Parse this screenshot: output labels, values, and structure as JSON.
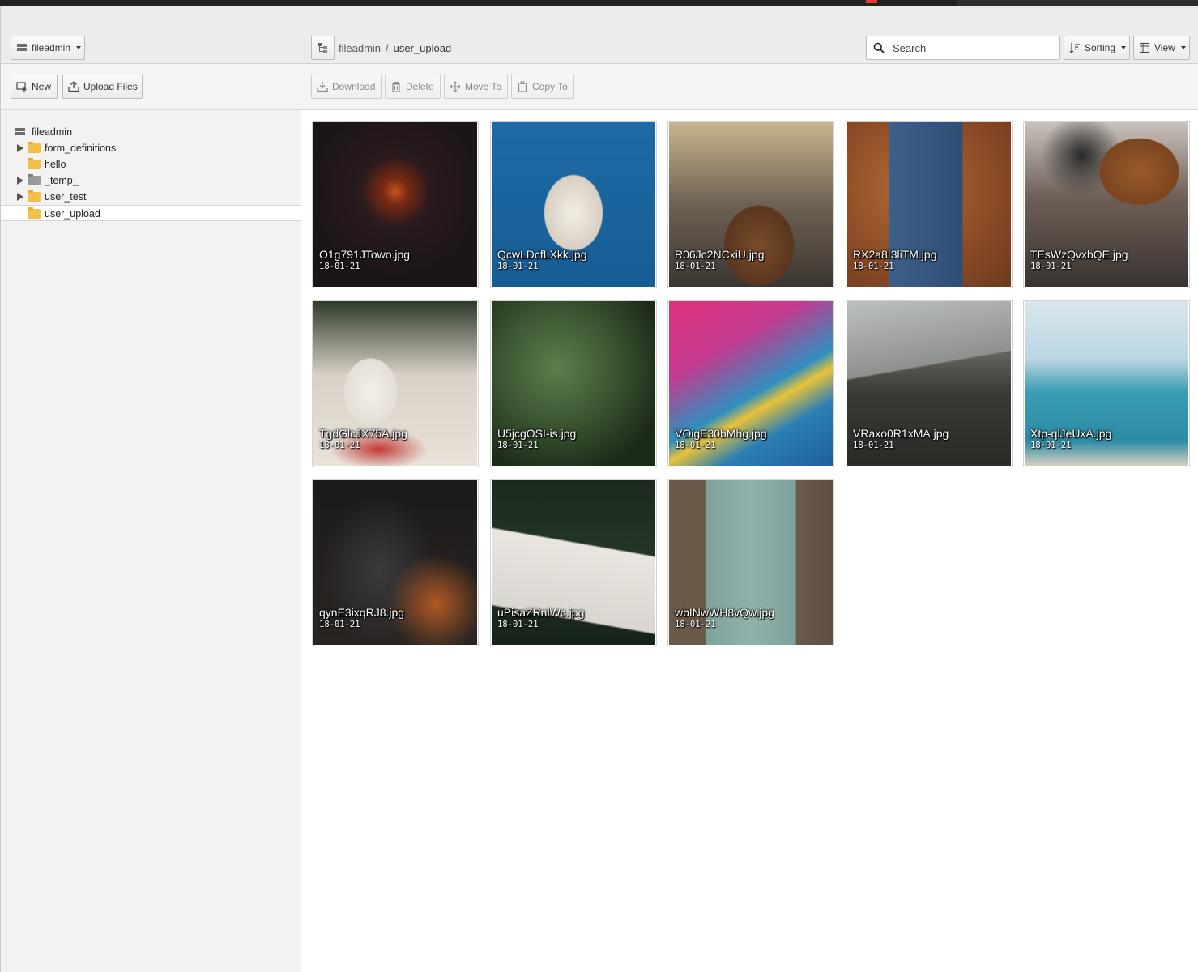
{
  "sidebar": {
    "storage_label": "fileadmin",
    "new_label": "New",
    "upload_label": "Upload Files",
    "tree": {
      "root": "fileadmin",
      "items": [
        {
          "label": "form_definitions",
          "expandable": true,
          "color": "yellow"
        },
        {
          "label": "hello",
          "expandable": false,
          "color": "yellow"
        },
        {
          "label": "_temp_",
          "expandable": true,
          "color": "grey"
        },
        {
          "label": "user_test",
          "expandable": true,
          "color": "yellow"
        },
        {
          "label": "user_upload",
          "expandable": false,
          "color": "yellow",
          "selected": true
        }
      ]
    }
  },
  "header": {
    "breadcrumb": [
      "fileadmin",
      "user_upload"
    ],
    "search_placeholder": "Search",
    "sorting_label": "Sorting",
    "view_label": "View"
  },
  "toolbar": {
    "download_label": "Download",
    "delete_label": "Delete",
    "move_label": "Move To",
    "copy_label": "Copy To"
  },
  "files": [
    {
      "name": "O1g791JTowo.jpg",
      "date": "18-01-21",
      "bg": "radial-gradient(circle at 50% 42%, #c4541f 0%, #7a2a14 10%, #2a1a1c 28%, #1b1518 70%)"
    },
    {
      "name": "QcwLDcfLXkk.jpg",
      "date": "18-01-21",
      "bg": "radial-gradient(ellipse 35% 45% at 50% 55%, #f2ede4 0%, #d8cfc2 50%, transparent 52%), linear-gradient(#1e6aa6, #165d95)"
    },
    {
      "name": "R06Jc2NCxiU.jpg",
      "date": "18-01-21",
      "bg": "radial-gradient(ellipse 35% 40% at 55% 75%, #7a4b2a 0%, #5a3620 60%, transparent 62%), linear-gradient(#c9b58f, #6e6152 50%, #3c3531)"
    },
    {
      "name": "RX2a8I3liTM.jpg",
      "date": "18-01-21",
      "bg": "linear-gradient(90deg, transparent 25%, #3c5f8a 26%, #2f4e75 70%, transparent 71%), radial-gradient(circle at 40% 40%, #b46a35, #8a4a25 60%, #6c3a1f)"
    },
    {
      "name": "TEsWzQvxbQE.jpg",
      "date": "18-01-21",
      "bg": "radial-gradient(ellipse 30% 25% at 70% 30%, #9a5a2a 0%, #7b4520 80%, transparent 82%), radial-gradient(ellipse 25% 25% at 35% 20%, #2a2a2a 0%, transparent 100%), linear-gradient(#c9c3bd, #6f6058 45%, #3a3330)"
    },
    {
      "name": "TgdGlcJX75A.jpg",
      "date": "18-01-21",
      "bg": "radial-gradient(ellipse 20% 25% at 35% 55%, #f3f0ea 0%, #e4ded5 80%, transparent 82%), radial-gradient(ellipse 30% 12% at 40% 90%, #c23a35 0%, transparent 100%), linear-gradient(#2f3a28, #d9d1c6 45%, #e8e2da)"
    },
    {
      "name": "U5jcgOSI-is.jpg",
      "date": "18-01-21",
      "bg": "radial-gradient(circle at 40% 40%, #5f7d4e 0%, #3c5732 40%, #1c2a18 80%)"
    },
    {
      "name": "VOigE30bMhg.jpg",
      "date": "18-01-21",
      "bg": "linear-gradient(150deg, #e0307a 0%, #c33b8f 30%, #2f8fbf 55%, #e8c23a 62%, #2b7fb4 75%, #1f5f99 100%)"
    },
    {
      "name": "VRaxo0R1xMA.jpg",
      "date": "18-01-21",
      "bg": "linear-gradient(170deg, #bcc0bf 0%, #8e918f 40%, transparent 41%), linear-gradient(#9a9b95, #3c3a35 55%, #2b2925)"
    },
    {
      "name": "Xtp-qlJeUxA.jpg",
      "date": "18-01-21",
      "bg": "linear-gradient(#d9e6ec 0%, #bcd6e2 35%, #3a9db4 55%, #2d8ba4 85%, #d7cfc3 100%)"
    },
    {
      "name": "qynE3ixqRJ8.jpg",
      "date": "18-01-21",
      "bg": "radial-gradient(ellipse 30% 30% at 75% 75%, #b05a25 0%, transparent 100%), radial-gradient(ellipse 35% 45% at 40% 55%, #3a3a3e 0%, transparent 100%), linear-gradient(#1c1a1a, #2a2522)"
    },
    {
      "name": "uPisaZRnlWc.jpg",
      "date": "18-01-21",
      "bg": "linear-gradient(10deg, transparent 20%, #d9d6d0 21%, #e9e6e0 60%, transparent 61%), linear-gradient(#1b2a1d, #243826 50%, #172218)"
    },
    {
      "name": "wbINwWH8vQw.jpg",
      "date": "18-01-21",
      "bg": "linear-gradient(90deg, #6b5a4a 0%, #6b5a4a 22%, #7fa29a 23%, #8fb3aa 50%, #7fa29a 77%, #6b5a4a 78%, #5e4f41 100%)"
    }
  ]
}
